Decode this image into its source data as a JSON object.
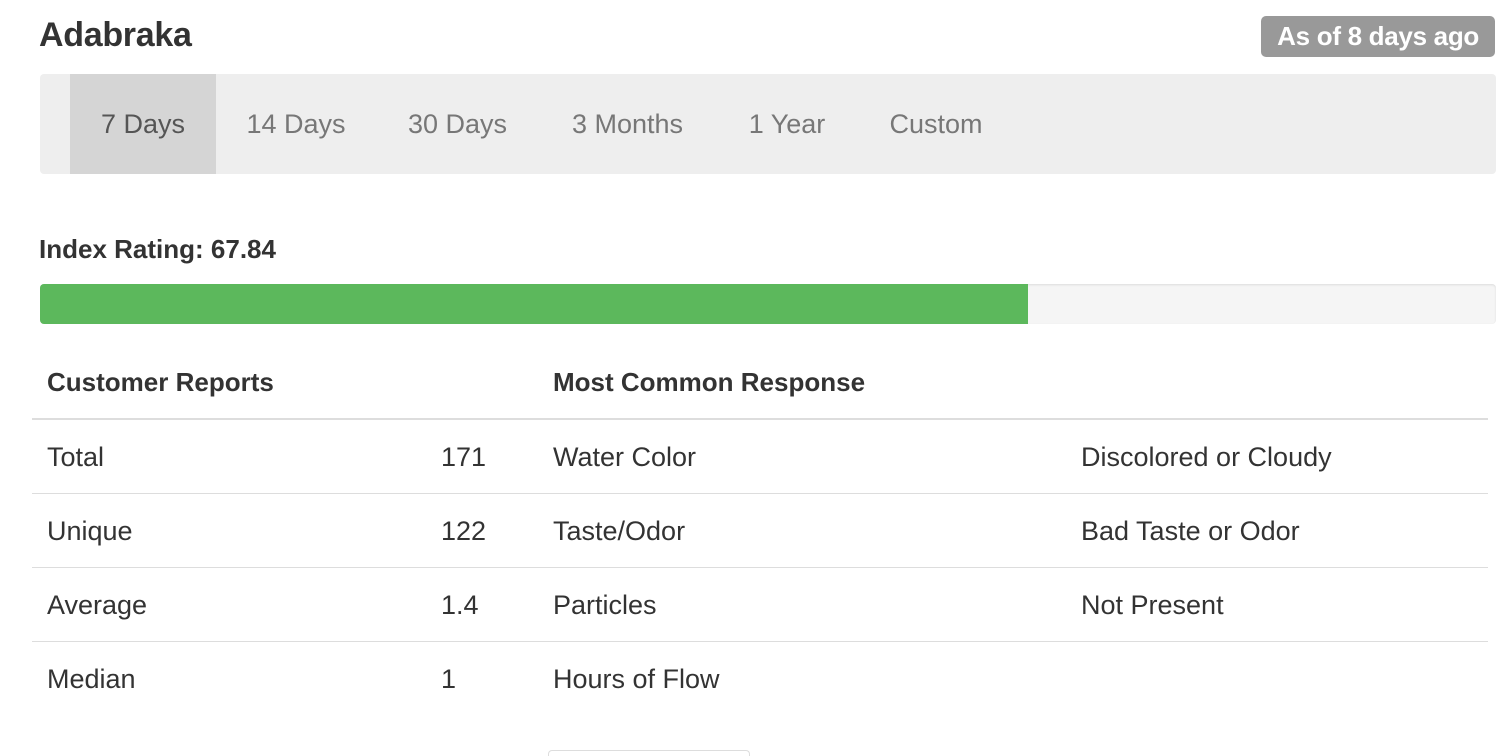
{
  "header": {
    "location_name": "Adabraka",
    "as_of": "As of 8 days ago"
  },
  "range_nav": {
    "tabs": [
      {
        "label": "7 Days",
        "active": true
      },
      {
        "label": "14 Days",
        "active": false
      },
      {
        "label": "30 Days",
        "active": false
      },
      {
        "label": "3 Months",
        "active": false
      },
      {
        "label": "1 Year",
        "active": false
      },
      {
        "label": "Custom",
        "active": false
      }
    ]
  },
  "index": {
    "label": "Index Rating: 67.84",
    "value": 67.84,
    "max": 100,
    "bar_color": "#5cb85c"
  },
  "table": {
    "headers": {
      "customer_reports": "Customer Reports",
      "most_common_response": "Most Common Response"
    },
    "rows": [
      {
        "stat": "Total",
        "count": "171",
        "category": "Water Color",
        "response": "Discolored or Cloudy"
      },
      {
        "stat": "Unique",
        "count": "122",
        "category": "Taste/Odor",
        "response": "Bad Taste or Odor"
      },
      {
        "stat": "Average",
        "count": "1.4",
        "category": "Particles",
        "response": "Not Present"
      },
      {
        "stat": "Median",
        "count": "1",
        "category": "Hours of Flow",
        "response": ""
      }
    ]
  }
}
